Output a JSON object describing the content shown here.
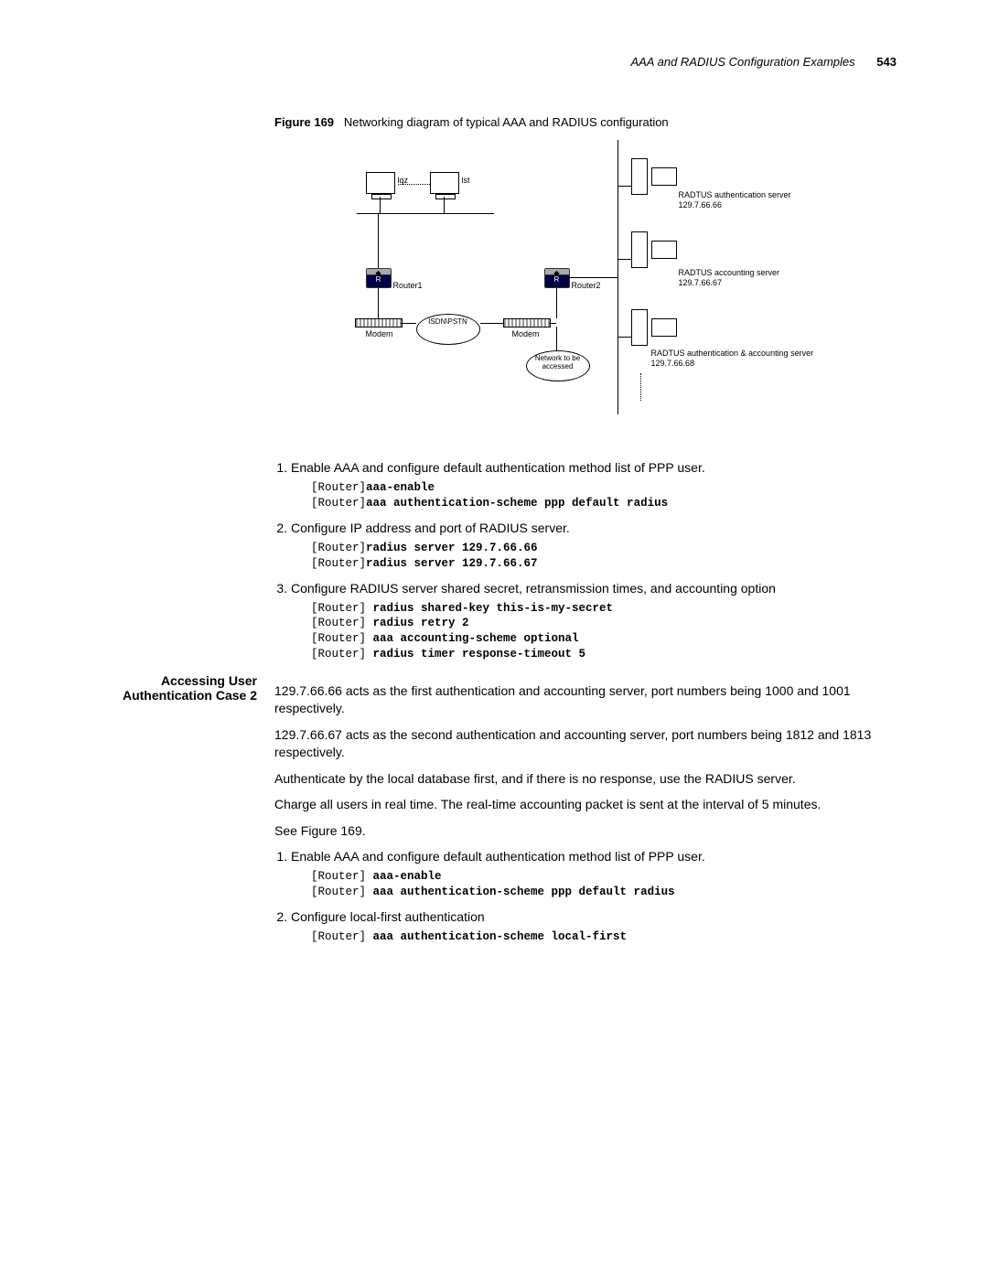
{
  "header": {
    "title": "AAA and RADIUS Configuration Examples",
    "page": "543"
  },
  "figure": {
    "label": "Figure 169",
    "caption": "Networking diagram of typical AAA and RADIUS configuration"
  },
  "diagram": {
    "pc1": "lqz",
    "pc2": "lst",
    "router1": "Router1",
    "router2": "Router2",
    "modem": "Modem",
    "isdn": "ISDN\\PSTN",
    "network": "Network to be accessed",
    "srv1_label": "RADTUS authentication server",
    "srv1_ip": "129.7.66.66",
    "srv2_label": "RADTUS accounting server",
    "srv2_ip": "129.7.66.67",
    "srv3_label": "RADTUS authentication & accounting server",
    "srv3_ip": "129.7.66.68"
  },
  "steps1": {
    "s1_text": "Enable AAA and configure default authentication method list of PPP user.",
    "s1_code_p1": "[Router]",
    "s1_code_c1": "aaa-enable",
    "s1_code_p2": "[Router]",
    "s1_code_c2": "aaa authentication-scheme ppp default radius",
    "s2_text": "Configure IP address and port of RADIUS server.",
    "s2_code_p1": "[Router]",
    "s2_code_c1": "radius server 129.7.66.66",
    "s2_code_p2": "[Router]",
    "s2_code_c2": "radius server 129.7.66.67",
    "s3_text": "Configure RADIUS server shared secret, retransmission times, and accounting option",
    "s3_code_p1": "[Router] ",
    "s3_code_c1": "radius shared-key this-is-my-secret",
    "s3_code_p2": "[Router] ",
    "s3_code_c2": "radius retry 2",
    "s3_code_p3": "[Router] ",
    "s3_code_c3": "aaa accounting-scheme optional",
    "s3_code_p4": "[Router] ",
    "s3_code_c4": "radius timer response-timeout 5"
  },
  "section2": {
    "heading_l1": "Accessing User",
    "heading_l2": "Authentication Case 2",
    "p1": "129.7.66.66 acts as the first authentication and accounting server, port numbers being 1000 and 1001 respectively.",
    "p2": "129.7.66.67 acts as the second authentication and accounting server, port numbers being 1812 and 1813 respectively.",
    "p3": "Authenticate by the local database first, and if there is no response, use the RADIUS server.",
    "p4": "Charge all users in real time. The real-time accounting packet is sent at the interval of 5 minutes.",
    "p5": "See Figure 169."
  },
  "steps2": {
    "s1_text": "Enable AAA and configure default authentication method list of PPP user.",
    "s1_code_p1": "[Router] ",
    "s1_code_c1": "aaa-enable",
    "s1_code_p2": "[Router] ",
    "s1_code_c2": "aaa authentication-scheme ppp default radius",
    "s2_text": "Configure local-first authentication",
    "s2_code_p1": "[Router] ",
    "s2_code_c1": "aaa authentication-scheme local-first"
  }
}
